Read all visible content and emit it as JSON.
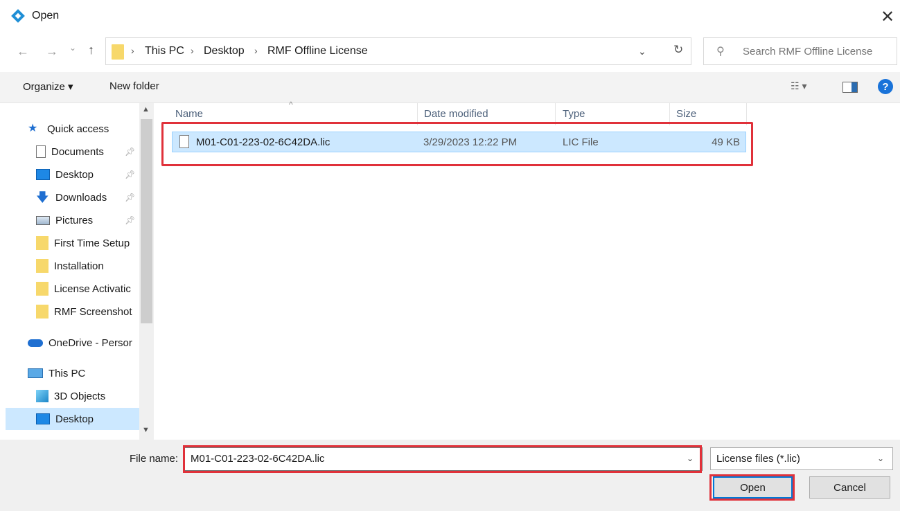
{
  "window": {
    "title": "Open",
    "close_label": "✕"
  },
  "nav_buttons": {
    "back": "←",
    "forward": "→",
    "recent": "⌄",
    "up": "↑"
  },
  "address": {
    "crumbs": [
      "This PC",
      "Desktop",
      "RMF Offline License"
    ],
    "separator": "›"
  },
  "search": {
    "placeholder": "Search RMF Offline License"
  },
  "toolbar": {
    "organize_label": "Organize ▾",
    "new_folder_label": "New folder",
    "help_label": "?"
  },
  "sidebar": {
    "items": [
      {
        "label": "Quick access",
        "icon": "star-icon"
      },
      {
        "label": "Documents",
        "icon": "documents-icon",
        "pinned": true
      },
      {
        "label": "Desktop",
        "icon": "desktop-icon",
        "pinned": true
      },
      {
        "label": "Downloads",
        "icon": "downloads-icon",
        "pinned": true
      },
      {
        "label": "Pictures",
        "icon": "pictures-icon",
        "pinned": true
      },
      {
        "label": "First Time Setup",
        "icon": "folder-icon"
      },
      {
        "label": "Installation",
        "icon": "folder-icon"
      },
      {
        "label": "License Activatic",
        "icon": "folder-icon"
      },
      {
        "label": "RMF Screenshot",
        "icon": "folder-icon"
      },
      {
        "label": "OneDrive - Persor",
        "icon": "onedrive-icon"
      },
      {
        "label": "This PC",
        "icon": "pc-icon"
      },
      {
        "label": "3D Objects",
        "icon": "3d-objects-icon"
      },
      {
        "label": "Desktop",
        "icon": "desktop-icon",
        "selected": true
      }
    ]
  },
  "file_list": {
    "columns": [
      "Name",
      "Date modified",
      "Type",
      "Size"
    ],
    "rows": [
      {
        "name": "M01-C01-223-02-6C42DA.lic",
        "date": "3/29/2023 12:22 PM",
        "type": "LIC File",
        "size": "49 KB",
        "selected": true
      }
    ]
  },
  "bottom": {
    "file_name_label": "File name:",
    "file_name_value": "M01-C01-223-02-6C42DA.lic",
    "filter_value": "License files (*.lic)",
    "open_label": "Open",
    "cancel_label": "Cancel"
  },
  "colors": {
    "highlight": "#e0313a",
    "selection": "#cce8ff",
    "accent": "#0078d7"
  }
}
